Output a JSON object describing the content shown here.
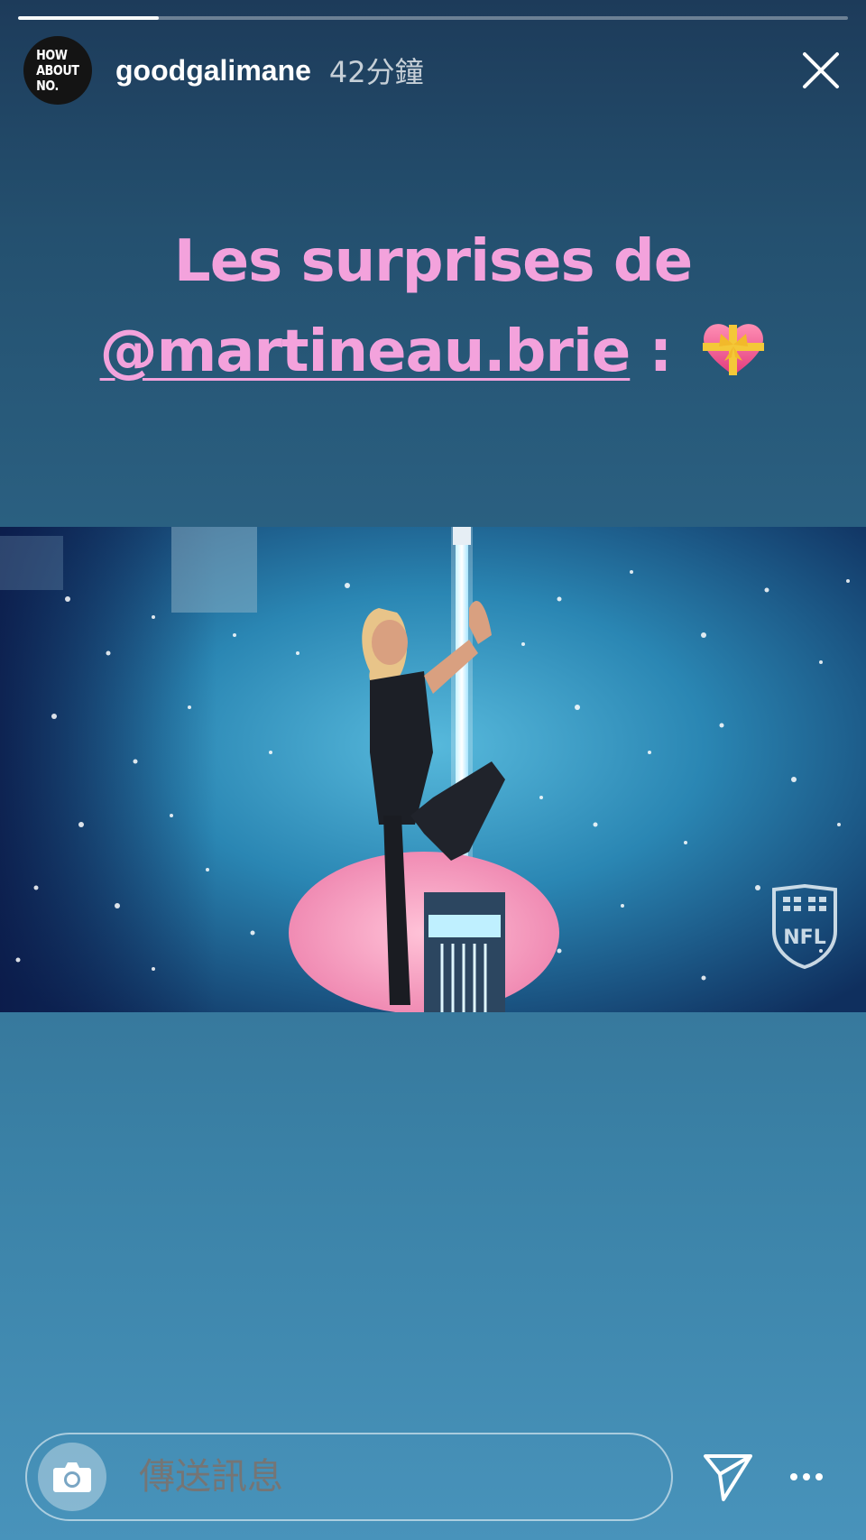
{
  "story": {
    "progress": 0.17,
    "avatar_text": "HOW\nABOUT\nNO.",
    "username": "goodgalimane",
    "time_ago": "42分鐘",
    "caption_line1": "Les surprises de",
    "caption_mention": "@martineau.brie",
    "caption_separator": " :",
    "watermark": "NFL"
  },
  "footer": {
    "message_placeholder": "傳送訊息"
  },
  "icons": {
    "close": "close-icon",
    "camera": "camera-icon",
    "send": "send-icon",
    "more": "more-icon",
    "heart": "heart-with-ribbon-emoji"
  }
}
